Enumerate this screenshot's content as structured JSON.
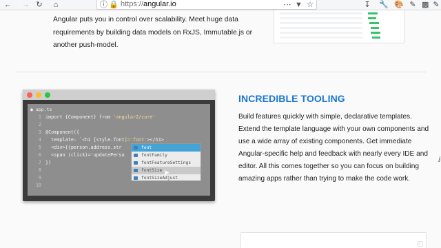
{
  "browser": {
    "url_protocol": "https://",
    "url_host": "angular.io",
    "icons": [
      "back-arrow-icon",
      "forward-arrow-icon",
      "refresh-icon",
      "home-icon",
      "info-icon",
      "lock-icon",
      "menu-dots-icon",
      "pocket-icon",
      "star-icon",
      "download-icon",
      "wrench-icon",
      "palette-icon",
      "brush-icon",
      "puzzle-icon",
      "dropper-icon"
    ]
  },
  "section_top": {
    "text": "Angular puts you in control over scalability. Meet huge data requirements by building data models on RxJS, Immutable.js or another push-model."
  },
  "editor": {
    "file_tab": "● app.ts",
    "lines": [
      {
        "n": "1",
        "pre": "import {Component} from ",
        "str": "'angular2/core'",
        "post": ""
      },
      {
        "n": "2",
        "pre": "",
        "str": "",
        "post": ""
      },
      {
        "n": "3",
        "pre": "@Component({",
        "str": "",
        "post": ""
      },
      {
        "n": "4",
        "pre": "  template: `<h1 [style.font",
        "str": "]='font'",
        "post": "></h1>"
      },
      {
        "n": "5",
        "pre": "  <div>{{person.address.str",
        "str": "",
        "post": ""
      },
      {
        "n": "6",
        "pre": "  <span (click)='updatePerso",
        "str": "",
        "post": ""
      },
      {
        "n": "7",
        "pre": "})",
        "str": "",
        "post": ""
      },
      {
        "n": "8",
        "pre": "",
        "str": "",
        "post": ""
      },
      {
        "n": "9",
        "pre": "",
        "str": "",
        "post": ""
      },
      {
        "n": "10",
        "pre": "",
        "str": "",
        "post": ""
      }
    ],
    "autocomplete": [
      "font",
      "fontFamily",
      "fontFeatureSettings",
      "fontSize",
      "fontSizeAdjust"
    ]
  },
  "feature": {
    "title": "INCREDIBLE TOOLING",
    "text": "Build features quickly with simple, declarative templates. Extend the template language with your own components and use a wide array of existing components. Get immediate Angular-specific help and feedback with nearly every IDE and editor. All this comes together so you can focus on building amazing apps rather than trying to make the code work."
  },
  "colors": {
    "title_blue": "#1976d2",
    "dot_red": "#ff5f56",
    "dot_yellow": "#ffbd2e",
    "dot_green": "#27c93f",
    "autocomplete_selected": "#44a4d6"
  }
}
